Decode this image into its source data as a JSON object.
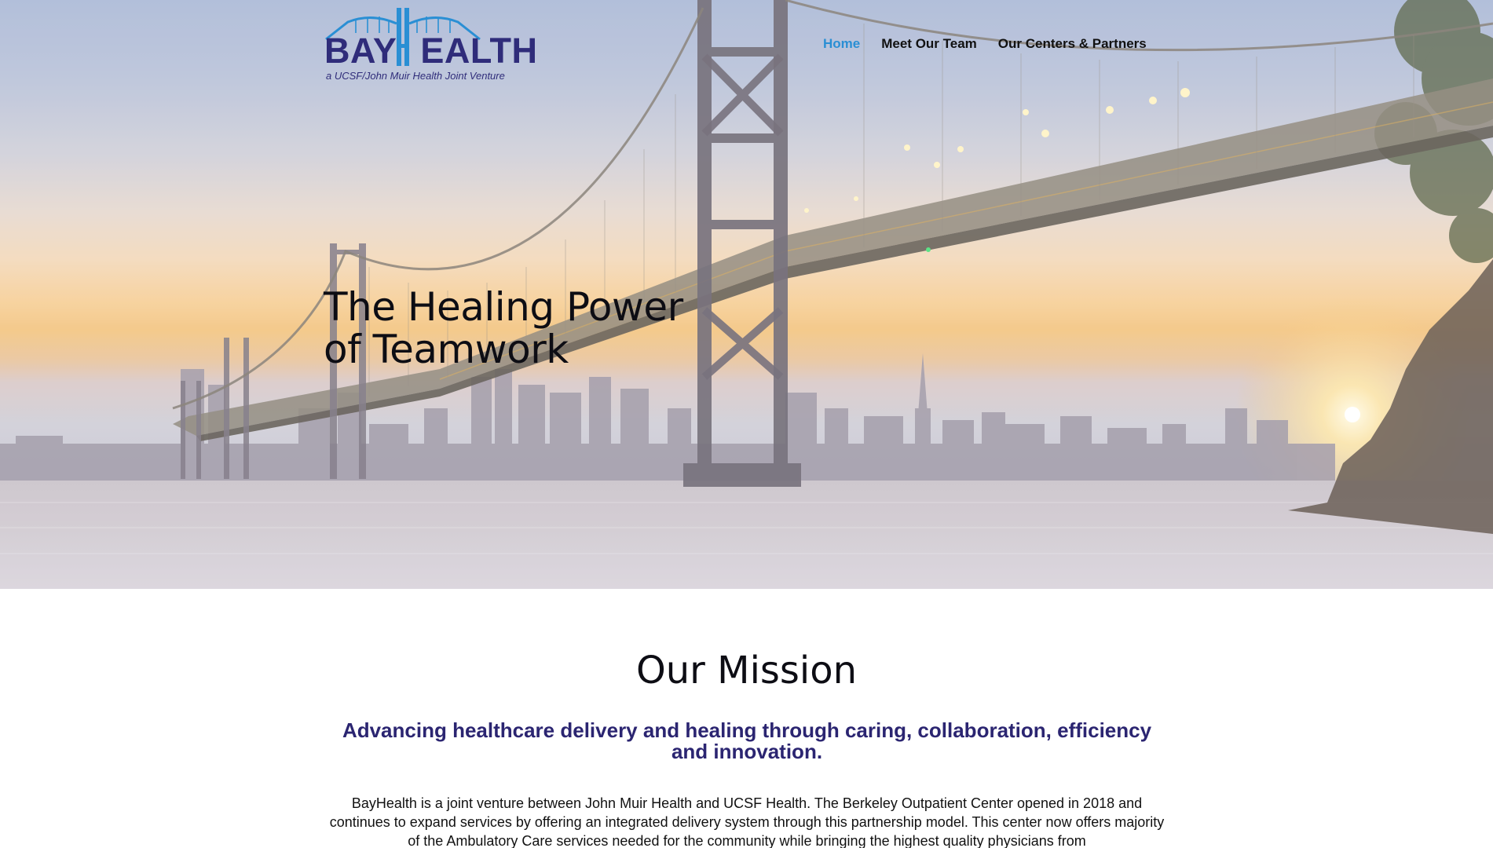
{
  "brand": {
    "logo_word_left": "BAY",
    "logo_word_right": "EALTH",
    "logo_tagline": "a UCSF/John Muir Health Joint Venture",
    "logo_icon": "bridge-h-logo-icon",
    "primary_color": "#2f2c7a",
    "accent_color": "#2a8fd4"
  },
  "nav": {
    "items": [
      {
        "label": "Home",
        "active": true
      },
      {
        "label": "Meet Our Team",
        "active": false
      },
      {
        "label": "Our Centers & Partners",
        "active": false
      }
    ]
  },
  "hero": {
    "title_line1": "The Healing Power",
    "title_line2": "of Teamwork"
  },
  "mission": {
    "heading": "Our Mission",
    "subheading": "Advancing healthcare delivery and healing through caring, collaboration, efficiency and innovation.",
    "body": "BayHealth is a joint venture between John Muir Health and UCSF Health.  The Berkeley Outpatient Center opened in 2018 and continues to expand services by offering an integrated delivery system through this partnership model. This center now offers majority of the Ambulatory Care services needed for the community while bringing the highest quality physicians from"
  }
}
